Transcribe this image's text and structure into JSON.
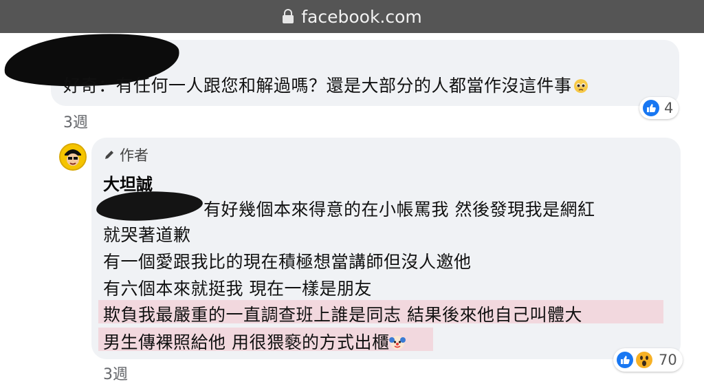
{
  "browser": {
    "url": "facebook.com"
  },
  "comment1": {
    "text": "好奇：有任何一人跟您和解過嗎？還是大部分的人都當作沒這件事",
    "reaction_count": "4",
    "time": "3週"
  },
  "reply": {
    "author_badge": "作者",
    "author_name": "大坦誠",
    "lines": [
      "有好幾個本來得意的在小帳罵我 然後發現我是網紅",
      "就哭著道歉",
      "有一個愛跟我比的現在積極想當講師但沒人邀他",
      "有六個本來就挺我 現在一樣是朋友",
      "欺負我最嚴重的一直調查班上誰是同志 結果後來他自己叫體大",
      "男生傳裸照給他 用很猥褻的方式出櫃"
    ],
    "reaction_count": "70",
    "time": "3週"
  },
  "colors": {
    "like": "#1877f2",
    "highlight": "#f2d3d9",
    "bubble": "#f0f2f5"
  }
}
